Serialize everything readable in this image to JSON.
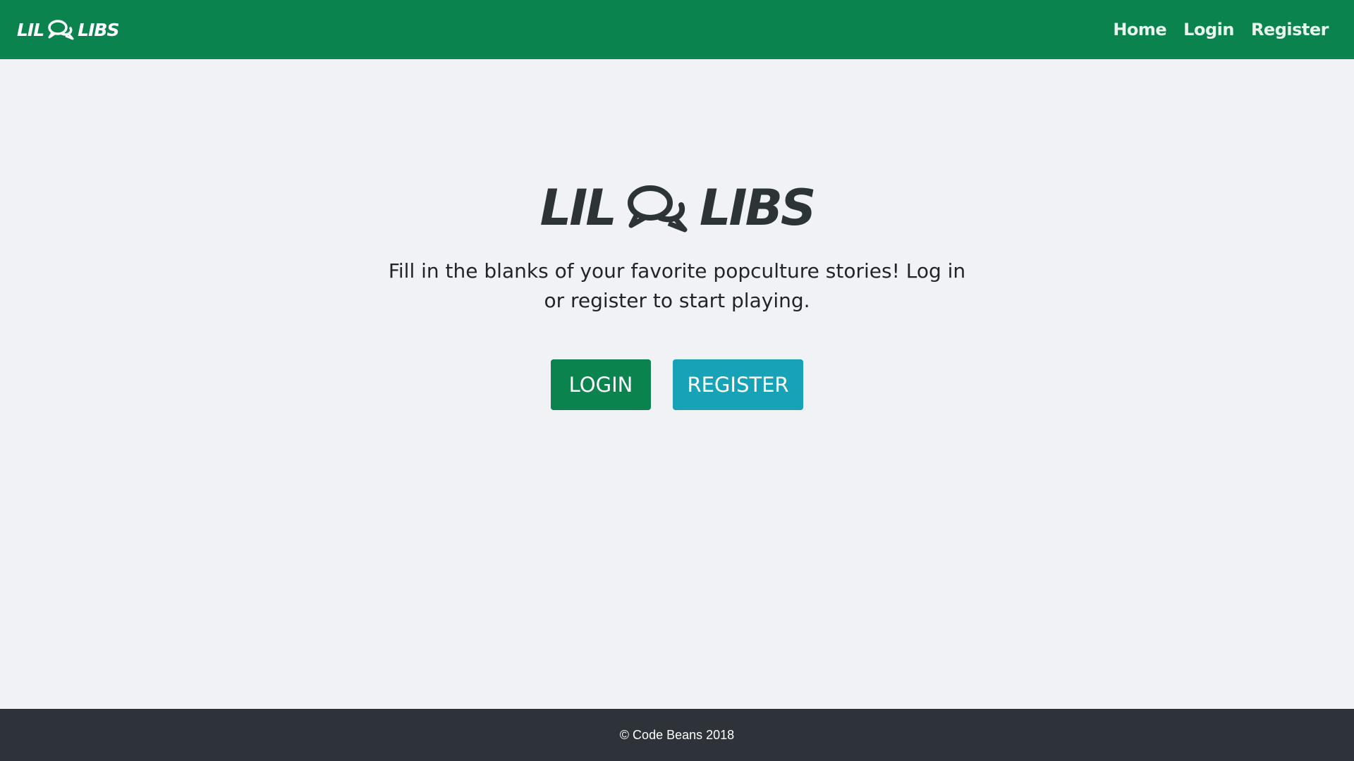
{
  "navbar": {
    "brand_left": "LIL",
    "brand_right": "LIBS",
    "links": [
      {
        "label": "Home"
      },
      {
        "label": "Login"
      },
      {
        "label": "Register"
      }
    ]
  },
  "hero": {
    "logo_left": "LIL",
    "logo_right": "LIBS",
    "tagline": "Fill in the blanks of your favorite popculture stories! Log in or register to start playing.",
    "login_button": "LOGIN",
    "register_button": "REGISTER"
  },
  "footer": {
    "copyright": "© Code Beans 2018"
  },
  "colors": {
    "brand_green": "#0a834f",
    "register_teal": "#17a2b8",
    "footer_dark": "#2d3338",
    "page_bg": "#f0f2f5"
  },
  "icons": {
    "logo_icon": "speech-bubbles-icon"
  }
}
